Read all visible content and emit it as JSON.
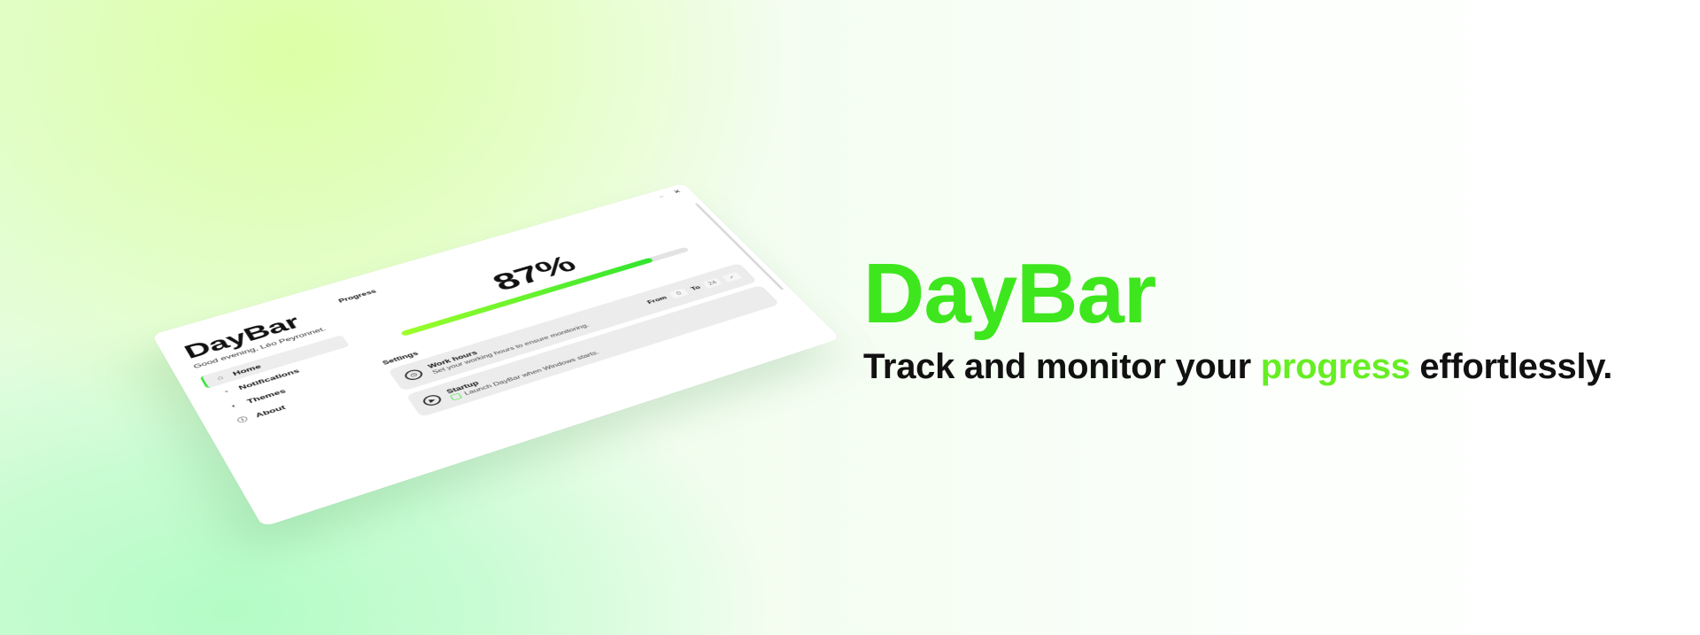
{
  "window": {
    "minimize_label": "–",
    "close_label": "×"
  },
  "sidebar": {
    "app_title": "DayBar",
    "greeting": "Good evening, Léo Peyronnet.",
    "items": [
      {
        "label": "Home",
        "icon": "home-icon",
        "glyph": "⌂"
      },
      {
        "label": "Notifications",
        "icon": "bell-icon",
        "glyph": "🔔"
      },
      {
        "label": "Themes",
        "icon": "contrast-icon",
        "glyph": "◐"
      },
      {
        "label": "About",
        "icon": "info-icon",
        "glyph": "ⓘ"
      }
    ]
  },
  "main": {
    "progress_label": "Progress",
    "progress_text": "87%",
    "progress_value": 0.87,
    "settings_label": "Settings",
    "work_hours": {
      "title": "Work hours",
      "subtitle": "Set your working hours to ensure monitoring.",
      "from_label": "From",
      "from_value": "0",
      "to_label": "To",
      "to_value": "24",
      "confirm_glyph": "✓"
    },
    "startup": {
      "title": "Startup",
      "subtitle": "Launch DayBar when Windows starts."
    }
  },
  "hero": {
    "title": "DayBar",
    "tagline_before": "Track and monitor your",
    "tagline_accent": "progress",
    "tagline_after": "effortlessly."
  },
  "colors": {
    "accent_green": "#3ee61e",
    "accent_lime": "#66ee23"
  }
}
